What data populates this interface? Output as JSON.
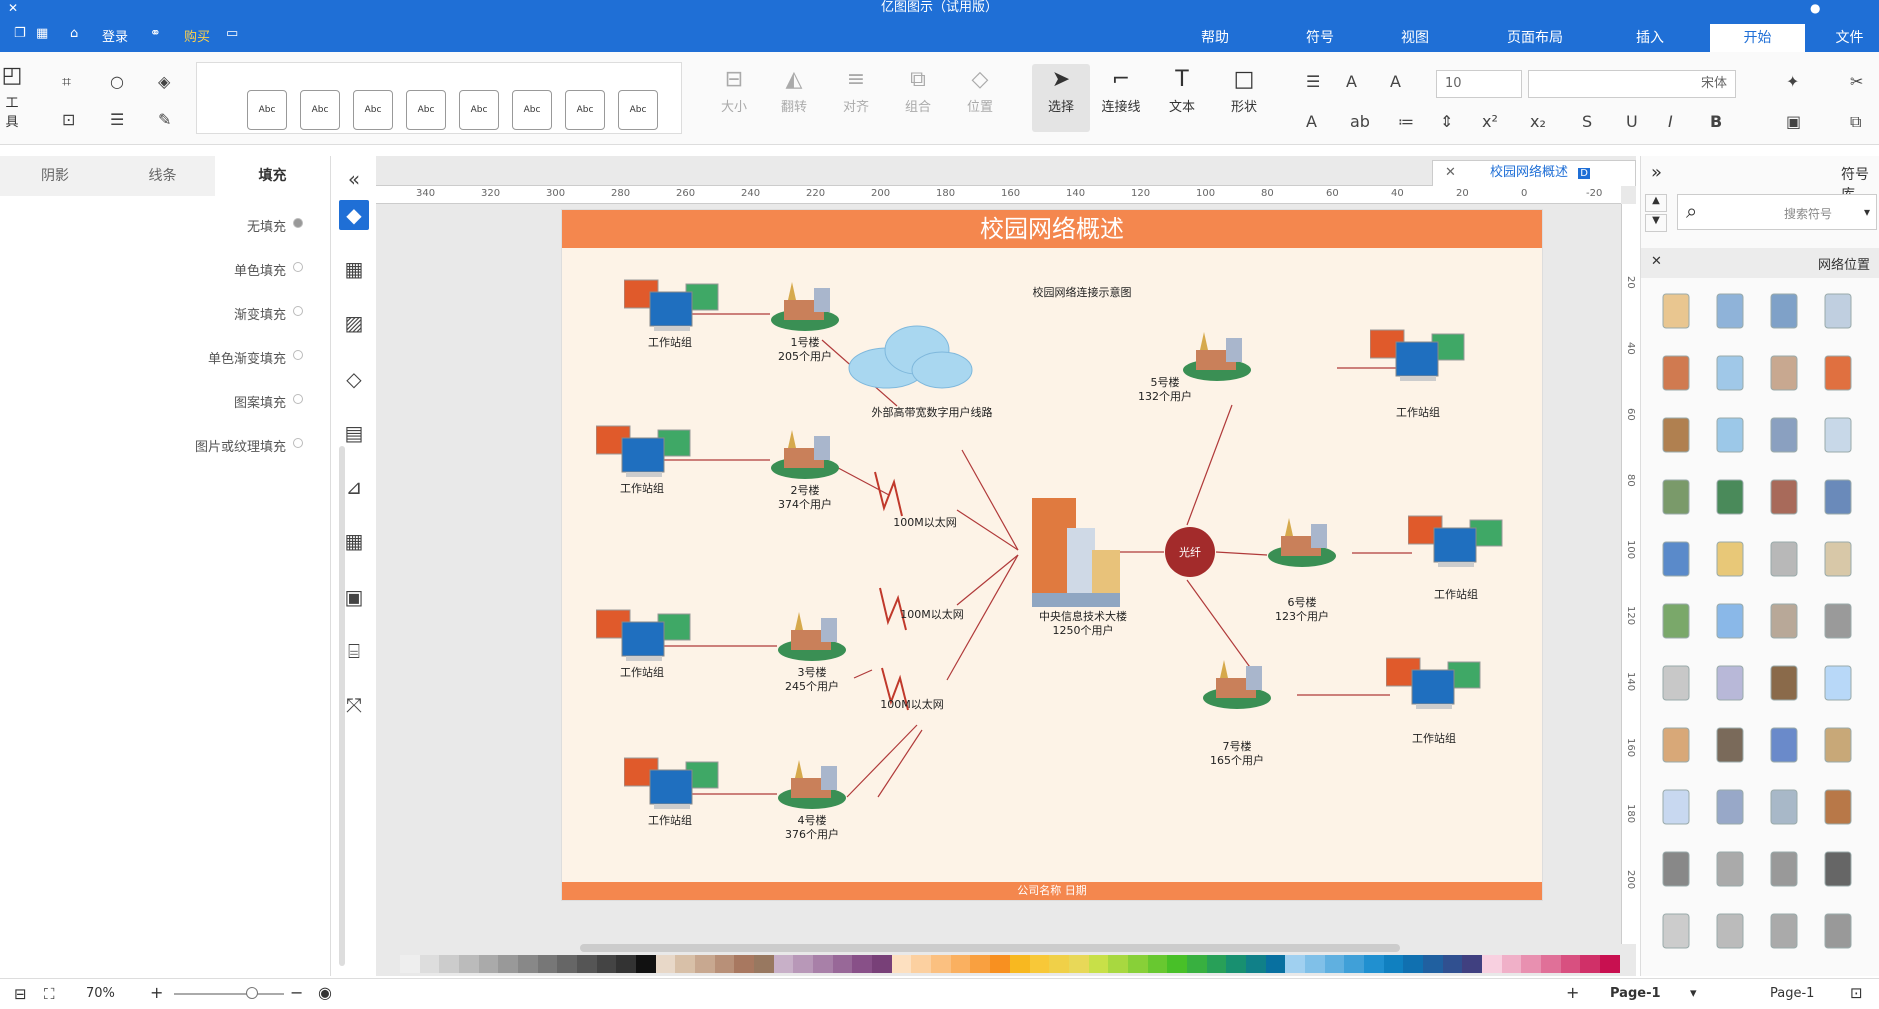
{
  "app": {
    "title": "亿图图示（试用版）",
    "window_controls": [
      "minimize",
      "restore",
      "close"
    ]
  },
  "menubar": {
    "tabs": [
      "文件",
      "开始",
      "插入",
      "页面布局",
      "视图",
      "符号",
      "帮助"
    ],
    "active": "开始",
    "quick": [
      "购买",
      "登录"
    ]
  },
  "ribbon": {
    "font_name": "宋体",
    "font_size": "10",
    "tools": [
      {
        "id": "shape",
        "label": "形状",
        "icon": "square-icon"
      },
      {
        "id": "text",
        "label": "文本",
        "icon": "text-icon"
      },
      {
        "id": "connector",
        "label": "连接线",
        "icon": "connector-icon"
      },
      {
        "id": "select",
        "label": "选择",
        "icon": "pointer-icon"
      },
      {
        "id": "position",
        "label": "位置",
        "icon": "layers-icon"
      },
      {
        "id": "group",
        "label": "组合",
        "icon": "group-icon"
      },
      {
        "id": "align",
        "label": "对齐",
        "icon": "align-icon"
      },
      {
        "id": "flip",
        "label": "翻转",
        "icon": "flip-icon"
      },
      {
        "id": "size",
        "label": "大小",
        "icon": "size-icon"
      }
    ],
    "left_tools": [
      "工具"
    ],
    "style_samples": [
      "Abc",
      "Abc",
      "Abc",
      "Abc",
      "Abc",
      "Abc",
      "Abc",
      "Abc"
    ]
  },
  "left_panel": {
    "tabs": [
      "填充",
      "线条",
      "阴影"
    ],
    "active": "填充",
    "options": [
      "无填充",
      "单色填充",
      "渐变填充",
      "单色渐变填充",
      "图案填充",
      "图片或纹理填充"
    ]
  },
  "document_tab": {
    "name": "校园网络概述"
  },
  "ruler": {
    "h_labels": [
      "-20",
      "0",
      "20",
      "40",
      "60",
      "80",
      "100",
      "120",
      "140",
      "160",
      "180",
      "200",
      "220",
      "240",
      "260",
      "280",
      "300",
      "320",
      "340"
    ],
    "v_labels": [
      "20",
      "40",
      "60",
      "80",
      "100",
      "120",
      "140",
      "160",
      "180",
      "200"
    ]
  },
  "diagram": {
    "title": "校园网络概述",
    "footer": "公司名称 日期",
    "note": "校园网络连接示意图",
    "center": {
      "line1": "中央信息技术大楼",
      "line2": "1250个用户"
    },
    "hub": "光纤",
    "cloud": "外部高带宽数字用户线路",
    "links": [
      "100M以太网",
      "100M以太网",
      "100M以太网"
    ],
    "buildings": [
      {
        "name": "1号楼",
        "users": "205个用户"
      },
      {
        "name": "2号楼",
        "users": "374个用户"
      },
      {
        "name": "3号楼",
        "users": "245个用户"
      },
      {
        "name": "4号楼",
        "users": "376个用户"
      },
      {
        "name": "5号楼",
        "users": "132个用户"
      },
      {
        "name": "6号楼",
        "users": "123个用户"
      },
      {
        "name": "7号楼",
        "users": "165个用户"
      }
    ],
    "workstation": "工作站组"
  },
  "right_panel": {
    "title": "符号库",
    "search_placeholder": "搜索符号",
    "section": "网络位置"
  },
  "statusbar": {
    "page_left": "Page-1",
    "page_tab": "Page-1",
    "zoom": "70%"
  }
}
